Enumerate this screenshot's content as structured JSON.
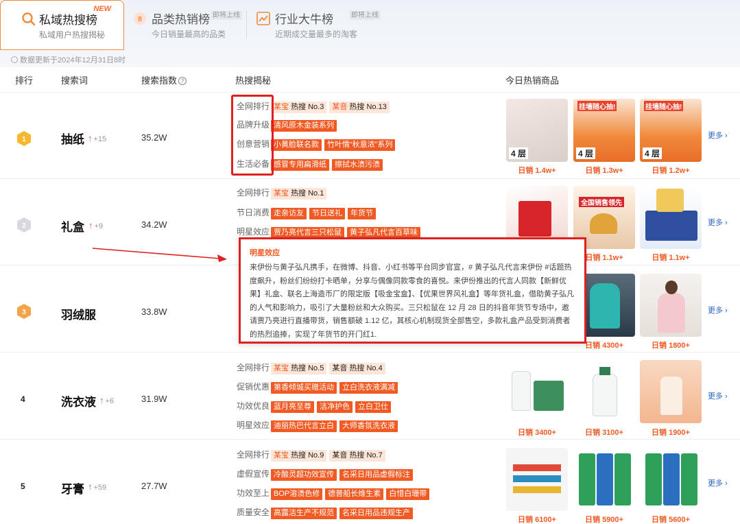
{
  "tabs": [
    {
      "title": "私域热搜榜",
      "sub": "私域用户热搜揭秘",
      "badge": "NEW"
    },
    {
      "title": "品类热销榜",
      "sub": "今日销量最高的品类",
      "badge": "即将上线"
    },
    {
      "title": "行业大牛榜",
      "sub": "近期成交量最多的淘客",
      "badge": "即将上线"
    }
  ],
  "update_text": "数据更新于2024年12月31日8时",
  "header": {
    "rank": "排行",
    "keyword": "搜索词",
    "index": "搜索指数",
    "secret": "热搜揭秘",
    "products": "今日热销商品"
  },
  "more_label": "更多",
  "rows": [
    {
      "rank": "1",
      "keyword": "抽纸",
      "change": "+15",
      "index": "35.2W",
      "sections": [
        {
          "label": "全网排行",
          "plat": [
            [
              "某宝",
              "热搜 No.3"
            ],
            [
              "某音",
              "热搜 No.13"
            ]
          ]
        },
        {
          "label": "品牌升级",
          "tags": [
            "清风原木金装系列"
          ]
        },
        {
          "label": "创意营销",
          "tags": [
            "小黄脸联名款",
            "竹叶情“秋意浓”系列"
          ]
        },
        {
          "label": "生活必备",
          "tags": [
            "感冒专用扁滑纸",
            "擦拭水渍污渍"
          ]
        }
      ],
      "sales": [
        "日销 1.4w+",
        "日销 1.3w+",
        "日销 1.2w+"
      ],
      "product_texts": [
        [
          "挂墙随心抽!",
          "4 层"
        ],
        [
          "挂墙随心抽!",
          "4 层"
        ],
        [
          "挂墙随心抽!",
          "4 层"
        ]
      ]
    },
    {
      "rank": "2",
      "keyword": "礼盒",
      "change": "+9",
      "index": "34.2W",
      "sections": [
        {
          "label": "全网排行",
          "plat": [
            [
              "某宝",
              "热搜 No.1"
            ]
          ]
        },
        {
          "label": "节日消费",
          "tags": [
            "走亲访友",
            "节日送礼",
            "年货节"
          ]
        },
        {
          "label": "明星效应",
          "tags": [
            "贾乃亮代言三只松鼠",
            "黄子弘凡代言百草味"
          ]
        }
      ],
      "sales": [
        "日销 1.1w+",
        "日销 1.1w+"
      ],
      "product_texts": [
        [
          "全国销售领先"
        ]
      ]
    },
    {
      "rank": "3",
      "keyword": "羽绒服",
      "change": "",
      "index": "33.8W",
      "sections": [],
      "sales": [
        "日销 4300+",
        "日销 1800+"
      ]
    },
    {
      "rank": "4",
      "keyword": "洗衣液",
      "change": "+6",
      "index": "31.9W",
      "sections": [
        {
          "label": "全网排行",
          "plat": [
            [
              "某宝",
              "热搜 No.5"
            ],
            [
              "某音",
              "热搜 No.4"
            ]
          ]
        },
        {
          "label": "促销优惠",
          "tags": [
            "第香倾城买赠活动",
            "立白洗衣液满减"
          ]
        },
        {
          "label": "功效优良",
          "tags": [
            "蓝月亮至尊",
            "洁净护色",
            "立白卫仕"
          ]
        },
        {
          "label": "明星效应",
          "tags": [
            "迪丽热巴代言立白",
            "大师香氛洗衣液"
          ]
        }
      ],
      "sales": [
        "日销 3400+",
        "日销 3100+",
        "日销 1900+"
      ]
    },
    {
      "rank": "5",
      "keyword": "牙膏",
      "change": "+59",
      "index": "27.7W",
      "sections": [
        {
          "label": "全网排行",
          "plat": [
            [
              "某宝",
              "热搜 No.9"
            ],
            [
              "某音",
              "热搜 No.7"
            ]
          ]
        },
        {
          "label": "虚假宣传",
          "tags": [
            "冷酸灵超功效宣传",
            "名采日用品虚假标注"
          ]
        },
        {
          "label": "功效至上",
          "tags": [
            "BOP溶渍色修",
            "德普船长维生素",
            "白惜白珊带"
          ]
        },
        {
          "label": "质量安全",
          "tags": [
            "高露洁生产不规范",
            "名采日用品违规生产"
          ]
        }
      ],
      "sales": [
        "日销 6100+",
        "日销 5900+",
        "日销 5600+"
      ]
    }
  ],
  "popup": {
    "title": "明星效应",
    "text": "来伊份与黄子弘凡携手，在微博、抖音、小红书等平台同步官宣，# 黄子弘凡代言来伊份 #话题热度飙升，粉丝们纷纷打卡晒单，分享与偶像同款零食的喜悦。来伊份推出的代言人同款【新鲜优果】礼盒、联名上海造币厂的限定版【吸金宝盒】、【优果世界风礼盒】等年货礼盒，借助黄子弘凡的人气和影响力，吸引了大量粉丝和大众购买。三只松鼠在 12 月 28 日的抖音年货节专场中，邀请贾乃亮进行直播带货，销售额破 1.12 亿，其核心机制现货全部售空，多款礼盒产品受到消费者的热烈追捧，实现了年货节的开门红1."
  },
  "colors": {
    "accent": "#f15a22",
    "highlight": "#e02020",
    "link": "#2a66c8"
  }
}
